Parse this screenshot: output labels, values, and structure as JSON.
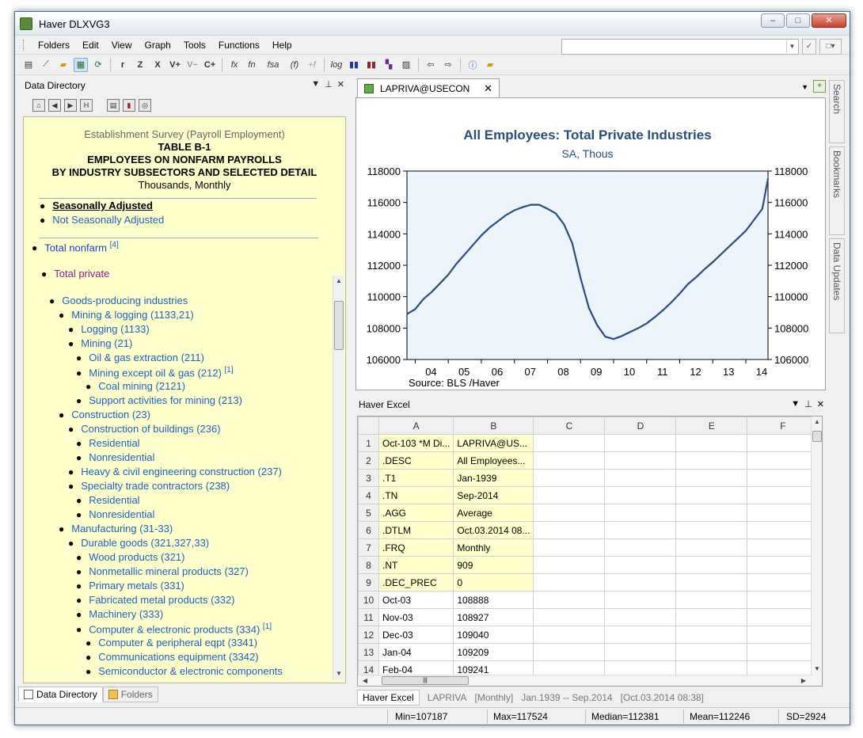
{
  "window": {
    "title": "Haver DLXVG3"
  },
  "menu": [
    "Folders",
    "Edit",
    "View",
    "Graph",
    "Tools",
    "Functions",
    "Help"
  ],
  "toolbar": {
    "log_label": "log",
    "fsa_label": "fsa"
  },
  "left_pane": {
    "title": "Data Directory",
    "header": {
      "survey": "Establishment Survey (Payroll Employment)",
      "table": "TABLE B-1",
      "line1": "EMPLOYEES ON NONFARM PAYROLLS",
      "line2": "BY INDUSTRY SUBSECTORS AND SELECTED DETAIL",
      "units": "Thousands, Monthly"
    },
    "adjust_options": [
      "Seasonally Adjusted",
      "Not Seasonally Adjusted"
    ],
    "tree": [
      {
        "label": "Total nonfarm",
        "sup": "[4]"
      },
      {
        "label": "Total private"
      },
      {
        "label": "Goods-producing industries"
      },
      {
        "label": "Mining & logging (1133,21)"
      },
      {
        "label": "Logging (1133)"
      },
      {
        "label": "Mining (21)"
      },
      {
        "label": "Oil & gas extraction (211)"
      },
      {
        "label": "Mining except oil & gas (212)",
        "sup": "[1]"
      },
      {
        "label": "Coal mining (2121)"
      },
      {
        "label": "Support activities for mining (213)"
      },
      {
        "label": "Construction (23)"
      },
      {
        "label": "Construction of buildings (236)"
      },
      {
        "label": "Residential"
      },
      {
        "label": "Nonresidential"
      },
      {
        "label": "Heavy & civil engineering construction (237)"
      },
      {
        "label": "Specialty trade contractors (238)"
      },
      {
        "label": "Residential"
      },
      {
        "label": "Nonresidential"
      },
      {
        "label": "Manufacturing (31-33)"
      },
      {
        "label": "Durable goods (321,327,33)"
      },
      {
        "label": "Wood products (321)"
      },
      {
        "label": "Nonmetallic mineral products (327)"
      },
      {
        "label": "Primary metals (331)"
      },
      {
        "label": "Fabricated metal products (332)"
      },
      {
        "label": "Machinery (333)"
      },
      {
        "label": "Computer & electronic products (334)",
        "sup": "[1]"
      },
      {
        "label": "Computer & peripheral eqpt (3341)"
      },
      {
        "label": "Communications equipment (3342)"
      },
      {
        "label": "Semiconductor & electronic components"
      }
    ],
    "tabs": [
      "Data Directory",
      "Folders"
    ]
  },
  "graph_tab": {
    "label": "LAPRIVA@USECON"
  },
  "right_sidebar": [
    "Search",
    "Bookmarks",
    "Data Updates"
  ],
  "chart_data": {
    "type": "line",
    "title": "All Employees: Total Private Industries",
    "subtitle": "SA, Thous",
    "source": "Source:  BLS /Haver",
    "ylim": [
      106000,
      118000
    ],
    "y_ticks": [
      106000,
      108000,
      110000,
      112000,
      114000,
      116000,
      118000
    ],
    "x_tick_labels": [
      "04",
      "05",
      "06",
      "07",
      "08",
      "09",
      "10",
      "11",
      "12",
      "13",
      "14"
    ],
    "grid": false,
    "line_color": "#2a4d7a",
    "plot_bg": "#eef4fb",
    "series": [
      {
        "x": [
          2003.75,
          2004.0,
          2004.25,
          2004.5,
          2004.75,
          2005.0,
          2005.25,
          2005.5,
          2005.75,
          2006.0,
          2006.25,
          2006.5,
          2006.75,
          2007.0,
          2007.25,
          2007.5,
          2007.75,
          2008.0,
          2008.25,
          2008.5,
          2008.75,
          2009.0,
          2009.25,
          2009.5,
          2009.75,
          2010.0,
          2010.25,
          2010.5,
          2010.75,
          2011.0,
          2011.25,
          2011.5,
          2011.75,
          2012.0,
          2012.25,
          2012.5,
          2012.75,
          2013.0,
          2013.25,
          2013.5,
          2013.75,
          2014.0,
          2014.25,
          2014.5,
          2014.67
        ],
        "y": [
          108888,
          109209,
          109850,
          110300,
          110850,
          111400,
          112100,
          112700,
          113300,
          113900,
          114400,
          114800,
          115200,
          115500,
          115700,
          115850,
          115850,
          115600,
          115300,
          114600,
          113400,
          111200,
          109300,
          108200,
          107450,
          107300,
          107500,
          107750,
          108000,
          108300,
          108700,
          109150,
          109650,
          110200,
          110800,
          111250,
          111750,
          112200,
          112700,
          113200,
          113700,
          114200,
          114900,
          115600,
          117524
        ]
      }
    ]
  },
  "excel": {
    "title": "Haver Excel",
    "columns": [
      "A",
      "B",
      "C",
      "D",
      "E",
      "F"
    ],
    "rows": [
      {
        "n": "1",
        "a": "Oct-103 *M Di...",
        "b": "LAPRIVA@US...",
        "meta": true
      },
      {
        "n": "2",
        "a": ".DESC",
        "b": "All Employees...",
        "meta": true
      },
      {
        "n": "3",
        "a": ".T1",
        "b": "Jan-1939",
        "meta": true
      },
      {
        "n": "4",
        "a": ".TN",
        "b": "Sep-2014",
        "meta": true
      },
      {
        "n": "5",
        "a": ".AGG",
        "b": "Average",
        "meta": true
      },
      {
        "n": "6",
        "a": ".DTLM",
        "b": "Oct.03.2014 08...",
        "meta": true
      },
      {
        "n": "7",
        "a": ".FRQ",
        "b": "Monthly",
        "meta": true
      },
      {
        "n": "8",
        "a": ".NT",
        "b": "909",
        "meta": true
      },
      {
        "n": "9",
        "a": ".DEC_PREC",
        "b": "0",
        "meta": true
      },
      {
        "n": "10",
        "a": "Oct-03",
        "b": "108888",
        "meta": false
      },
      {
        "n": "11",
        "a": "Nov-03",
        "b": "108927",
        "meta": false
      },
      {
        "n": "12",
        "a": "Dec-03",
        "b": "109040",
        "meta": false
      },
      {
        "n": "13",
        "a": "Jan-04",
        "b": "109209",
        "meta": false
      },
      {
        "n": "14",
        "a": "Feb-04",
        "b": "109241",
        "meta": false
      }
    ],
    "tabs": {
      "active": "Haver Excel",
      "series": "LAPRIVA",
      "freq": "[Monthly]",
      "range": "Jan.1939 -- Sep.2014",
      "updated": "[Oct.03.2014 08:38]"
    }
  },
  "status": {
    "min": "Min=107187",
    "max": "Max=117524",
    "median": "Median=112381",
    "mean": "Mean=112246",
    "sd": "SD=2924"
  }
}
